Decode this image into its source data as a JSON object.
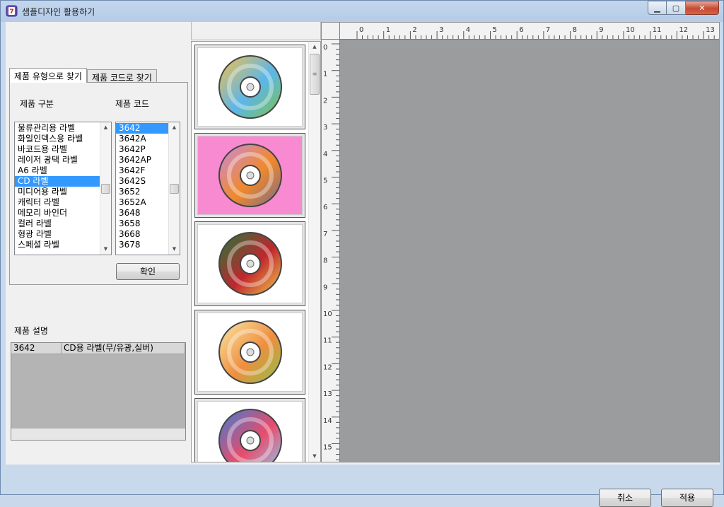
{
  "window": {
    "title": "샘플디자인 활용하기"
  },
  "tabs": [
    {
      "label": "제품 유형으로 찾기",
      "active": true
    },
    {
      "label": "제품 코드로 찾기",
      "active": false
    }
  ],
  "category": {
    "header": "제품 구분",
    "items": [
      "물류관리용 라벨",
      "화일인덱스용 라벨",
      "바코드용 라벨",
      "레이저 광택 라벨",
      "A6 라벨",
      "CD 라벨",
      "미디어용 라벨",
      "캐릭터 라벨",
      "메모리 바인더",
      "컬러 라벨",
      "형광 라벨",
      "스페셜 라벨"
    ],
    "selected": "CD 라벨"
  },
  "code": {
    "header": "제품 코드",
    "items": [
      "3642",
      "3642A",
      "3642P",
      "3642AP",
      "3642F",
      "3642S",
      "3652",
      "3652A",
      "3648",
      "3658",
      "3668",
      "3678"
    ],
    "selected": "3642"
  },
  "confirm_label": "확인",
  "description": {
    "header": "제품 설명",
    "code": "3642",
    "text": "CD용 라벨(무/유광,실버)"
  },
  "thumbnails": [
    {
      "name": "cd-design-1",
      "bg": "#ffffff",
      "colors": [
        "#f7c04a",
        "#5bb6ea",
        "#7cc24a"
      ]
    },
    {
      "name": "cd-design-2",
      "bg": "#f78ad0",
      "colors": [
        "#c98be0",
        "#f0892b",
        "#7a6a8a"
      ]
    },
    {
      "name": "cd-design-3",
      "bg": "#ffffff",
      "colors": [
        "#1e7a3a",
        "#c0262d",
        "#f2c94c"
      ]
    },
    {
      "name": "cd-design-4",
      "bg": "#ffffff",
      "colors": [
        "#f9e8a6",
        "#ef8e3e",
        "#8cc04a"
      ]
    },
    {
      "name": "cd-design-5",
      "bg": "#ffffff",
      "colors": [
        "#3b7fd4",
        "#e94b6b",
        "#8ec9f0"
      ]
    }
  ],
  "ruler": {
    "top_labels": [
      "0",
      "1",
      "2",
      "3",
      "4",
      "5",
      "6",
      "7",
      "8",
      "9",
      "10",
      "11",
      "12",
      "13"
    ],
    "left_labels": [
      "0",
      "1",
      "2",
      "3",
      "4",
      "5",
      "6",
      "7",
      "8",
      "9",
      "10",
      "11",
      "12",
      "13",
      "14",
      "15"
    ]
  },
  "footer": {
    "cancel_label": "취소",
    "apply_label": "적용"
  },
  "colors": {
    "selection": "#3399ff",
    "canvas": "#9a9c9e",
    "close_button": "#c74a32"
  }
}
